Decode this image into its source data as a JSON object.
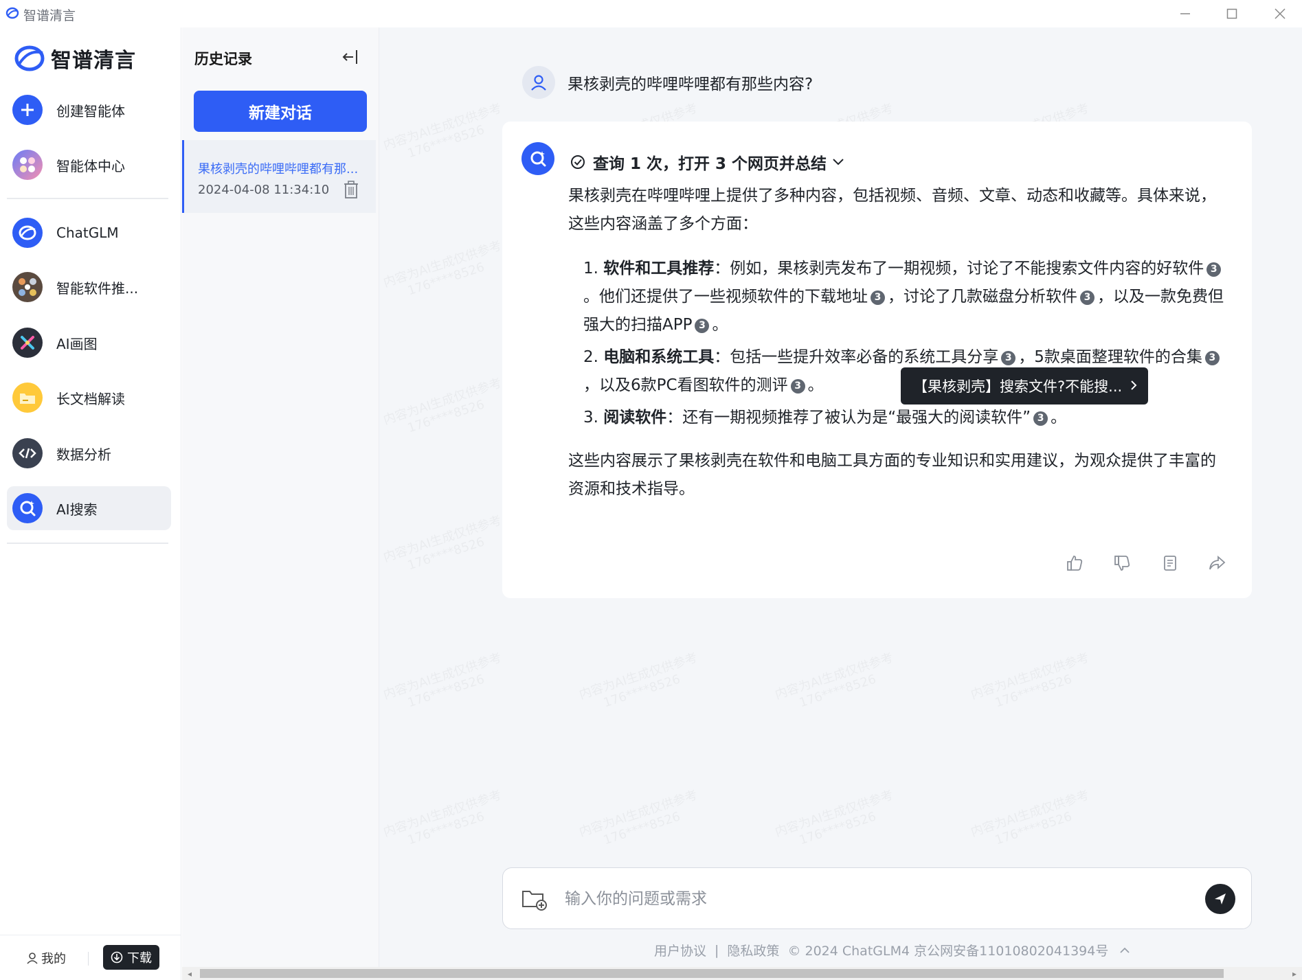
{
  "window": {
    "title": "智谱清言",
    "minimize_icon": "minimize-icon",
    "maximize_icon": "maximize-icon",
    "close_icon": "close-icon"
  },
  "brand": {
    "name": "智谱清言",
    "accent": "#2e5df5"
  },
  "sidebar": {
    "top_items": [
      {
        "label": "创建智能体",
        "icon": "plus-icon"
      },
      {
        "label": "智能体中心",
        "icon": "agent-center-icon"
      }
    ],
    "items": [
      {
        "label": "ChatGLM",
        "icon": "chatglm-logo-icon"
      },
      {
        "label": "智能软件推...",
        "icon": "software-avatar-icon"
      },
      {
        "label": "AI画图",
        "icon": "ai-draw-icon"
      },
      {
        "label": "长文档解读",
        "icon": "folder-icon"
      },
      {
        "label": "数据分析",
        "icon": "code-icon"
      },
      {
        "label": "AI搜索",
        "icon": "ai-search-icon",
        "active": true
      }
    ],
    "footer": {
      "mine_label": "我的",
      "download_label": "下载"
    }
  },
  "history": {
    "title": "历史记录",
    "new_chat_label": "新建对话",
    "items": [
      {
        "title": "果核剥壳的哔哩哔哩都有那...",
        "time": "2024-04-08 11:34:10"
      }
    ]
  },
  "chat": {
    "user_question": "果核剥壳的哔哩哔哩都有那些内容?",
    "search_status": "查询 1 次，打开 3 个网页并总结",
    "intro": "果核剥壳在哔哩哔哩上提供了多种内容，包括视频、音频、文章、动态和收藏等。具体来说，这些内容涵盖了多个方面：",
    "list": [
      {
        "num": "1.",
        "heading": "软件和工具推荐",
        "parts": [
          "：例如，果核剥壳发布了一期视频，讨论了不能搜索文件内容的好软件",
          "。他们还提供了一些视频软件的下载地址",
          "，讨论了几款磁盘分析软件",
          "，以及一款免费但强大的扫描APP",
          "。"
        ]
      },
      {
        "num": "2.",
        "heading": "电脑和系统工具",
        "parts": [
          "：包括一些提升效率必备的系统工具分享",
          "，5款桌面整理软件的合集",
          "，以及6款PC看图软件的测评",
          "。"
        ]
      },
      {
        "num": "3.",
        "heading": "阅读软件",
        "parts": [
          "：还有一期视频推荐了被认为是“最强大的阅读软件”",
          "。"
        ]
      }
    ],
    "citation_label": "3",
    "conclusion": "这些内容展示了果核剥壳在软件和电脑工具方面的专业知识和实用建议，为观众提供了丰富的资源和技术指导。",
    "tooltip": "【果核剥壳】搜索文件?不能搜...",
    "actions": [
      "thumbs-up-icon",
      "thumbs-down-icon",
      "copy-icon",
      "share-icon"
    ]
  },
  "input": {
    "placeholder": "输入你的问题或需求"
  },
  "footer": {
    "terms": "用户协议",
    "privacy": "隐私政策",
    "copyright": "© 2024 ChatGLM4 京公网安备11010802041394号"
  },
  "watermark": {
    "line1": "内容为AI生成仅供参考",
    "line2": "176****8526"
  }
}
